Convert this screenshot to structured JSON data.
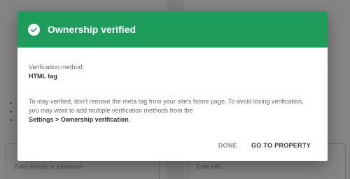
{
  "dialog": {
    "title": "Ownership verified",
    "method_label": "Verification method:",
    "method_value": "HTML tag",
    "info_text": "To stay verified, don't remove the meta tag from your site's home page. To avoid losing verification, you may want to add multiple verification methods from the",
    "info_link": "Settings > Ownership verification",
    "info_end": ".",
    "done_label": "DONE",
    "go_label": "GO TO PROPERTY",
    "header_color": "#1e9d5a",
    "icon": "check-circle-icon"
  },
  "background": {
    "domain_placeholder": "Enter domain or subdomain",
    "url_placeholder": "Enter URL"
  }
}
